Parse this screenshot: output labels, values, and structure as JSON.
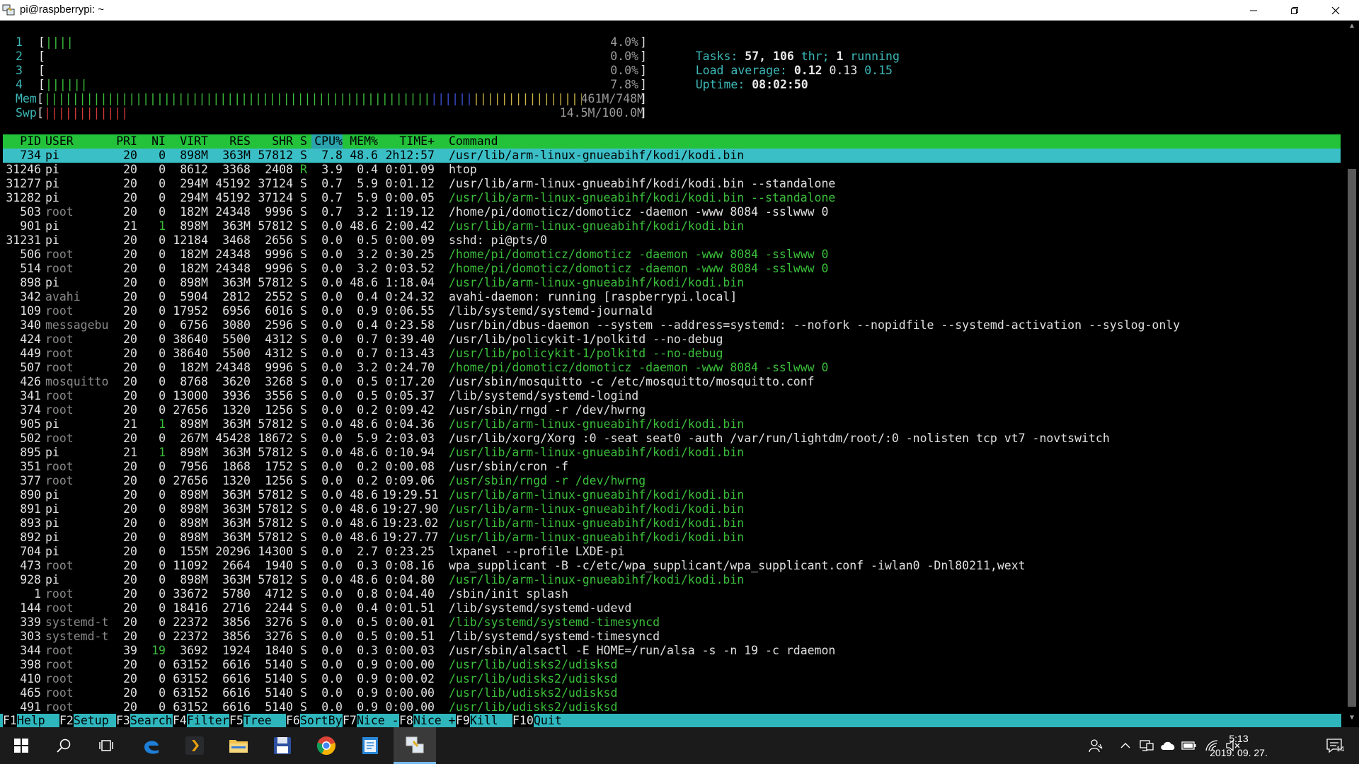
{
  "window": {
    "title": "pi@raspberrypi: ~",
    "min_icon": "minimize-icon",
    "max_icon": "restore-icon",
    "close_icon": "close-icon"
  },
  "meters": {
    "cpus": [
      {
        "label": "1",
        "bars": "||||",
        "value": "4.0%"
      },
      {
        "label": "2",
        "bars": "",
        "value": "0.0%"
      },
      {
        "label": "3",
        "bars": "",
        "value": "0.0%"
      },
      {
        "label": "4",
        "bars": "||||||",
        "value": "7.8%"
      }
    ],
    "mem": {
      "label": "Mem",
      "bars_green": "|||||||||||||||||||||||||||||||||||||||||||||||||||||||",
      "bars_blue": "||||||",
      "bars_yellow": "|||||||||||||||||||",
      "value": "461M/748M"
    },
    "swp": {
      "label": "Swp",
      "bars": "||||||||||||",
      "value": "14.5M/100.0M"
    }
  },
  "info": {
    "tasks_label": "Tasks:",
    "tasks_value": "57,",
    "threads_value": "106",
    "threads_label": "thr;",
    "running_value": "1",
    "running_label": "running",
    "load_label": "Load average:",
    "load1": "0.12",
    "load5": "0.13",
    "load15": "0.15",
    "uptime_label": "Uptime:",
    "uptime_value": "08:02:50"
  },
  "columns": {
    "pid": "PID",
    "user": "USER",
    "pri": "PRI",
    "ni": "NI",
    "virt": "VIRT",
    "res": "RES",
    "shr": "SHR",
    "s": "S",
    "cpu": "CPU%",
    "mem": "MEM%",
    "time": "TIME+",
    "cmd": "Command"
  },
  "processes": [
    {
      "pid": "734",
      "user": "pi",
      "pri": "20",
      "ni": "0",
      "virt": "898M",
      "res": "363M",
      "shr": "57812",
      "s": "S",
      "cpu": "7.8",
      "mem": "48.6",
      "time": "2h12:57",
      "cmd": "/usr/lib/arm-linux-gnueabihf/kodi/kodi.bin",
      "selected": true
    },
    {
      "pid": "31246",
      "user": "pi",
      "pri": "20",
      "ni": "0",
      "virt": "8612",
      "res": "3368",
      "shr": "2408",
      "s": "R",
      "cpu": "3.9",
      "mem": "0.4",
      "time": "0:01.09",
      "cmd": "htop"
    },
    {
      "pid": "31277",
      "user": "pi",
      "pri": "20",
      "ni": "0",
      "virt": "294M",
      "res": "45192",
      "shr": "37124",
      "s": "S",
      "cpu": "0.7",
      "mem": "5.9",
      "time": "0:01.12",
      "cmd": "/usr/lib/arm-linux-gnueabihf/kodi/kodi.bin --standalone"
    },
    {
      "pid": "31282",
      "user": "pi",
      "pri": "20",
      "ni": "0",
      "virt": "294M",
      "res": "45192",
      "shr": "37124",
      "s": "S",
      "cpu": "0.7",
      "mem": "5.9",
      "time": "0:00.05",
      "cmd": "/usr/lib/arm-linux-gnueabihf/kodi/kodi.bin --standalone",
      "thread": true
    },
    {
      "pid": "503",
      "user": "root",
      "pri": "20",
      "ni": "0",
      "virt": "182M",
      "res": "24348",
      "shr": "9996",
      "s": "S",
      "cpu": "0.7",
      "mem": "3.2",
      "time": "1:19.12",
      "cmd": "/home/pi/domoticz/domoticz -daemon -www 8084 -sslwww 0"
    },
    {
      "pid": "901",
      "user": "pi",
      "pri": "21",
      "ni": "1",
      "virt": "898M",
      "res": "363M",
      "shr": "57812",
      "s": "S",
      "cpu": "0.0",
      "mem": "48.6",
      "time": "2:00.42",
      "cmd": "/usr/lib/arm-linux-gnueabihf/kodi/kodi.bin",
      "thread": true
    },
    {
      "pid": "31231",
      "user": "pi",
      "pri": "20",
      "ni": "0",
      "virt": "12184",
      "res": "3468",
      "shr": "2656",
      "s": "S",
      "cpu": "0.0",
      "mem": "0.5",
      "time": "0:00.09",
      "cmd": "sshd: pi@pts/0"
    },
    {
      "pid": "506",
      "user": "root",
      "pri": "20",
      "ni": "0",
      "virt": "182M",
      "res": "24348",
      "shr": "9996",
      "s": "S",
      "cpu": "0.0",
      "mem": "3.2",
      "time": "0:30.25",
      "cmd": "/home/pi/domoticz/domoticz -daemon -www 8084 -sslwww 0",
      "thread": true
    },
    {
      "pid": "514",
      "user": "root",
      "pri": "20",
      "ni": "0",
      "virt": "182M",
      "res": "24348",
      "shr": "9996",
      "s": "S",
      "cpu": "0.0",
      "mem": "3.2",
      "time": "0:03.52",
      "cmd": "/home/pi/domoticz/domoticz -daemon -www 8084 -sslwww 0",
      "thread": true
    },
    {
      "pid": "898",
      "user": "pi",
      "pri": "20",
      "ni": "0",
      "virt": "898M",
      "res": "363M",
      "shr": "57812",
      "s": "S",
      "cpu": "0.0",
      "mem": "48.6",
      "time": "1:18.04",
      "cmd": "/usr/lib/arm-linux-gnueabihf/kodi/kodi.bin",
      "thread": true
    },
    {
      "pid": "342",
      "user": "avahi",
      "pri": "20",
      "ni": "0",
      "virt": "5904",
      "res": "2812",
      "shr": "2552",
      "s": "S",
      "cpu": "0.0",
      "mem": "0.4",
      "time": "0:24.32",
      "cmd": "avahi-daemon: running [raspberrypi.local]"
    },
    {
      "pid": "109",
      "user": "root",
      "pri": "20",
      "ni": "0",
      "virt": "17952",
      "res": "6956",
      "shr": "6016",
      "s": "S",
      "cpu": "0.0",
      "mem": "0.9",
      "time": "0:06.55",
      "cmd": "/lib/systemd/systemd-journald"
    },
    {
      "pid": "340",
      "user": "messagebu",
      "pri": "20",
      "ni": "0",
      "virt": "6756",
      "res": "3080",
      "shr": "2596",
      "s": "S",
      "cpu": "0.0",
      "mem": "0.4",
      "time": "0:23.58",
      "cmd": "/usr/bin/dbus-daemon --system --address=systemd: --nofork --nopidfile --systemd-activation --syslog-only"
    },
    {
      "pid": "424",
      "user": "root",
      "pri": "20",
      "ni": "0",
      "virt": "38640",
      "res": "5500",
      "shr": "4312",
      "s": "S",
      "cpu": "0.0",
      "mem": "0.7",
      "time": "0:39.40",
      "cmd": "/usr/lib/policykit-1/polkitd --no-debug"
    },
    {
      "pid": "449",
      "user": "root",
      "pri": "20",
      "ni": "0",
      "virt": "38640",
      "res": "5500",
      "shr": "4312",
      "s": "S",
      "cpu": "0.0",
      "mem": "0.7",
      "time": "0:13.43",
      "cmd": "/usr/lib/policykit-1/polkitd --no-debug",
      "thread": true
    },
    {
      "pid": "507",
      "user": "root",
      "pri": "20",
      "ni": "0",
      "virt": "182M",
      "res": "24348",
      "shr": "9996",
      "s": "S",
      "cpu": "0.0",
      "mem": "3.2",
      "time": "0:24.70",
      "cmd": "/home/pi/domoticz/domoticz -daemon -www 8084 -sslwww 0",
      "thread": true
    },
    {
      "pid": "426",
      "user": "mosquitto",
      "pri": "20",
      "ni": "0",
      "virt": "8768",
      "res": "3620",
      "shr": "3268",
      "s": "S",
      "cpu": "0.0",
      "mem": "0.5",
      "time": "0:17.20",
      "cmd": "/usr/sbin/mosquitto -c /etc/mosquitto/mosquitto.conf"
    },
    {
      "pid": "341",
      "user": "root",
      "pri": "20",
      "ni": "0",
      "virt": "13000",
      "res": "3936",
      "shr": "3556",
      "s": "S",
      "cpu": "0.0",
      "mem": "0.5",
      "time": "0:05.37",
      "cmd": "/lib/systemd/systemd-logind"
    },
    {
      "pid": "374",
      "user": "root",
      "pri": "20",
      "ni": "0",
      "virt": "27656",
      "res": "1320",
      "shr": "1256",
      "s": "S",
      "cpu": "0.0",
      "mem": "0.2",
      "time": "0:09.42",
      "cmd": "/usr/sbin/rngd -r /dev/hwrng"
    },
    {
      "pid": "905",
      "user": "pi",
      "pri": "21",
      "ni": "1",
      "virt": "898M",
      "res": "363M",
      "shr": "57812",
      "s": "S",
      "cpu": "0.0",
      "mem": "48.6",
      "time": "0:04.36",
      "cmd": "/usr/lib/arm-linux-gnueabihf/kodi/kodi.bin",
      "thread": true
    },
    {
      "pid": "502",
      "user": "root",
      "pri": "20",
      "ni": "0",
      "virt": "267M",
      "res": "45428",
      "shr": "18672",
      "s": "S",
      "cpu": "0.0",
      "mem": "5.9",
      "time": "2:03.03",
      "cmd": "/usr/lib/xorg/Xorg :0 -seat seat0 -auth /var/run/lightdm/root/:0 -nolisten tcp vt7 -novtswitch"
    },
    {
      "pid": "895",
      "user": "pi",
      "pri": "21",
      "ni": "1",
      "virt": "898M",
      "res": "363M",
      "shr": "57812",
      "s": "S",
      "cpu": "0.0",
      "mem": "48.6",
      "time": "0:10.94",
      "cmd": "/usr/lib/arm-linux-gnueabihf/kodi/kodi.bin",
      "thread": true
    },
    {
      "pid": "351",
      "user": "root",
      "pri": "20",
      "ni": "0",
      "virt": "7956",
      "res": "1868",
      "shr": "1752",
      "s": "S",
      "cpu": "0.0",
      "mem": "0.2",
      "time": "0:00.08",
      "cmd": "/usr/sbin/cron -f"
    },
    {
      "pid": "377",
      "user": "root",
      "pri": "20",
      "ni": "0",
      "virt": "27656",
      "res": "1320",
      "shr": "1256",
      "s": "S",
      "cpu": "0.0",
      "mem": "0.2",
      "time": "0:09.06",
      "cmd": "/usr/sbin/rngd -r /dev/hwrng",
      "thread": true
    },
    {
      "pid": "890",
      "user": "pi",
      "pri": "20",
      "ni": "0",
      "virt": "898M",
      "res": "363M",
      "shr": "57812",
      "s": "S",
      "cpu": "0.0",
      "mem": "48.6",
      "time": "19:29.51",
      "cmd": "/usr/lib/arm-linux-gnueabihf/kodi/kodi.bin",
      "thread": true
    },
    {
      "pid": "891",
      "user": "pi",
      "pri": "20",
      "ni": "0",
      "virt": "898M",
      "res": "363M",
      "shr": "57812",
      "s": "S",
      "cpu": "0.0",
      "mem": "48.6",
      "time": "19:27.90",
      "cmd": "/usr/lib/arm-linux-gnueabihf/kodi/kodi.bin",
      "thread": true
    },
    {
      "pid": "893",
      "user": "pi",
      "pri": "20",
      "ni": "0",
      "virt": "898M",
      "res": "363M",
      "shr": "57812",
      "s": "S",
      "cpu": "0.0",
      "mem": "48.6",
      "time": "19:23.02",
      "cmd": "/usr/lib/arm-linux-gnueabihf/kodi/kodi.bin",
      "thread": true
    },
    {
      "pid": "892",
      "user": "pi",
      "pri": "20",
      "ni": "0",
      "virt": "898M",
      "res": "363M",
      "shr": "57812",
      "s": "S",
      "cpu": "0.0",
      "mem": "48.6",
      "time": "19:27.77",
      "cmd": "/usr/lib/arm-linux-gnueabihf/kodi/kodi.bin",
      "thread": true
    },
    {
      "pid": "704",
      "user": "pi",
      "pri": "20",
      "ni": "0",
      "virt": "155M",
      "res": "20296",
      "shr": "14300",
      "s": "S",
      "cpu": "0.0",
      "mem": "2.7",
      "time": "0:23.25",
      "cmd": "lxpanel --profile LXDE-pi"
    },
    {
      "pid": "473",
      "user": "root",
      "pri": "20",
      "ni": "0",
      "virt": "11092",
      "res": "2664",
      "shr": "1940",
      "s": "S",
      "cpu": "0.0",
      "mem": "0.3",
      "time": "0:08.16",
      "cmd": "wpa_supplicant -B -c/etc/wpa_supplicant/wpa_supplicant.conf -iwlan0 -Dnl80211,wext"
    },
    {
      "pid": "928",
      "user": "pi",
      "pri": "20",
      "ni": "0",
      "virt": "898M",
      "res": "363M",
      "shr": "57812",
      "s": "S",
      "cpu": "0.0",
      "mem": "48.6",
      "time": "0:04.80",
      "cmd": "/usr/lib/arm-linux-gnueabihf/kodi/kodi.bin",
      "thread": true
    },
    {
      "pid": "1",
      "user": "root",
      "pri": "20",
      "ni": "0",
      "virt": "33672",
      "res": "5780",
      "shr": "4712",
      "s": "S",
      "cpu": "0.0",
      "mem": "0.8",
      "time": "0:04.40",
      "cmd": "/sbin/init splash"
    },
    {
      "pid": "144",
      "user": "root",
      "pri": "20",
      "ni": "0",
      "virt": "18416",
      "res": "2716",
      "shr": "2244",
      "s": "S",
      "cpu": "0.0",
      "mem": "0.4",
      "time": "0:01.51",
      "cmd": "/lib/systemd/systemd-udevd"
    },
    {
      "pid": "339",
      "user": "systemd-t",
      "pri": "20",
      "ni": "0",
      "virt": "22372",
      "res": "3856",
      "shr": "3276",
      "s": "S",
      "cpu": "0.0",
      "mem": "0.5",
      "time": "0:00.01",
      "cmd": "/lib/systemd/systemd-timesyncd",
      "thread": true
    },
    {
      "pid": "303",
      "user": "systemd-t",
      "pri": "20",
      "ni": "0",
      "virt": "22372",
      "res": "3856",
      "shr": "3276",
      "s": "S",
      "cpu": "0.0",
      "mem": "0.5",
      "time": "0:00.51",
      "cmd": "/lib/systemd/systemd-timesyncd"
    },
    {
      "pid": "344",
      "user": "root",
      "pri": "39",
      "ni": "19",
      "virt": "3692",
      "res": "1924",
      "shr": "1840",
      "s": "S",
      "cpu": "0.0",
      "mem": "0.3",
      "time": "0:00.03",
      "cmd": "/usr/sbin/alsactl -E HOME=/run/alsa -s -n 19 -c rdaemon"
    },
    {
      "pid": "398",
      "user": "root",
      "pri": "20",
      "ni": "0",
      "virt": "63152",
      "res": "6616",
      "shr": "5140",
      "s": "S",
      "cpu": "0.0",
      "mem": "0.9",
      "time": "0:00.00",
      "cmd": "/usr/lib/udisks2/udisksd",
      "thread": true
    },
    {
      "pid": "410",
      "user": "root",
      "pri": "20",
      "ni": "0",
      "virt": "63152",
      "res": "6616",
      "shr": "5140",
      "s": "S",
      "cpu": "0.0",
      "mem": "0.9",
      "time": "0:00.02",
      "cmd": "/usr/lib/udisks2/udisksd",
      "thread": true
    },
    {
      "pid": "465",
      "user": "root",
      "pri": "20",
      "ni": "0",
      "virt": "63152",
      "res": "6616",
      "shr": "5140",
      "s": "S",
      "cpu": "0.0",
      "mem": "0.9",
      "time": "0:00.00",
      "cmd": "/usr/lib/udisks2/udisksd",
      "thread": true
    },
    {
      "pid": "491",
      "user": "root",
      "pri": "20",
      "ni": "0",
      "virt": "63152",
      "res": "6616",
      "shr": "5140",
      "s": "S",
      "cpu": "0.0",
      "mem": "0.9",
      "time": "0:00.00",
      "cmd": "/usr/lib/udisks2/udisksd",
      "thread": true
    }
  ],
  "fkeys": [
    {
      "key": "F1",
      "label": "Help  "
    },
    {
      "key": "F2",
      "label": "Setup "
    },
    {
      "key": "F3",
      "label": "Search"
    },
    {
      "key": "F4",
      "label": "Filter"
    },
    {
      "key": "F5",
      "label": "Tree  "
    },
    {
      "key": "F6",
      "label": "SortBy"
    },
    {
      "key": "F7",
      "label": "Nice -"
    },
    {
      "key": "F8",
      "label": "Nice +"
    },
    {
      "key": "F9",
      "label": "Kill  "
    },
    {
      "key": "F10",
      "label": "Quit  "
    }
  ],
  "taskbar": {
    "items": [
      {
        "name": "start-button",
        "icon": "windows-logo-icon"
      },
      {
        "name": "search-button",
        "icon": "search-icon"
      },
      {
        "name": "task-view-button",
        "icon": "task-view-icon"
      },
      {
        "name": "edge-button",
        "icon": "edge-icon"
      },
      {
        "name": "plex-button",
        "icon": "plex-icon"
      },
      {
        "name": "file-explorer-button",
        "icon": "folder-icon"
      },
      {
        "name": "save-app-button",
        "icon": "floppy-icon"
      },
      {
        "name": "chrome-button",
        "icon": "chrome-icon"
      },
      {
        "name": "notepad-button",
        "icon": "notepad-icon"
      },
      {
        "name": "putty-button",
        "icon": "putty-icon"
      }
    ],
    "time": "5:13",
    "date": "2019. 09. 27.",
    "notifications": "14"
  },
  "colors": {
    "header": "#23c23a",
    "selected": "#3bbfc6",
    "label": "#3db8b8",
    "green": "#3bbf3b",
    "red": "#d23a3a"
  }
}
